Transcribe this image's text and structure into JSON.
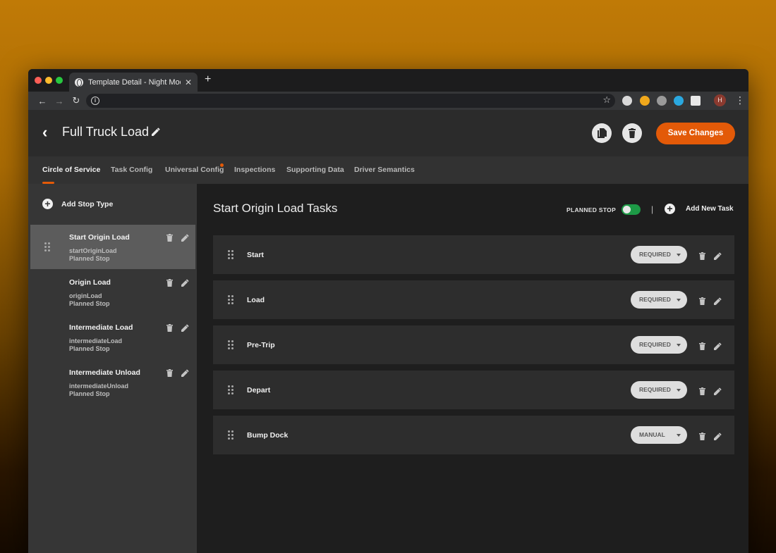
{
  "browser": {
    "tab_title": "Template Detail - Night Mode.png",
    "tab_close": "✕",
    "new_tab": "+",
    "avatar_initial": "H"
  },
  "header": {
    "back_glyph": "‹",
    "title": "Full Truck Load",
    "save_label": "Save Changes"
  },
  "tabs": [
    {
      "label": "Circle of Service",
      "active": true
    },
    {
      "label": "Task Config"
    },
    {
      "label": "Universal Config",
      "has_badge": true
    },
    {
      "label": "Inspections"
    },
    {
      "label": "Supporting Data"
    },
    {
      "label": "Driver Semantics"
    }
  ],
  "sidebar": {
    "add_label": "Add Stop Type",
    "stops": [
      {
        "name": "Start Origin Load",
        "key": "startOriginLoad",
        "type": "Planned Stop",
        "selected": true
      },
      {
        "name": "Origin Load",
        "key": "originLoad",
        "type": "Planned Stop"
      },
      {
        "name": "Intermediate Load",
        "key": "intermediateLoad",
        "type": "Planned Stop"
      },
      {
        "name": "Intermediate Unload",
        "key": "intermediateUnload",
        "type": "Planned Stop"
      }
    ]
  },
  "main": {
    "title": "Start Origin Load Tasks",
    "planned_stop_label": "PLANNED STOP",
    "planned_stop_on": true,
    "separator": "|",
    "add_task_label": "Add New Task",
    "tasks": [
      {
        "name": "Start",
        "requirement": "REQUIRED"
      },
      {
        "name": "Load",
        "requirement": "REQUIRED"
      },
      {
        "name": "Pre-Trip",
        "requirement": "REQUIRED"
      },
      {
        "name": "Depart",
        "requirement": "REQUIRED"
      },
      {
        "name": "Bump Dock",
        "requirement": "MANUAL"
      }
    ]
  },
  "colors": {
    "accent": "#e35a08",
    "toggle_on": "#1d9a46"
  }
}
